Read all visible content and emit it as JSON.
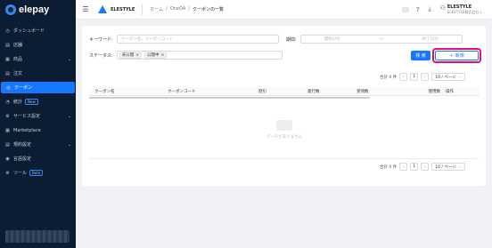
{
  "sidebar": {
    "brand": "elepay",
    "items": [
      {
        "icon": "◷",
        "label": "ダッシュボード",
        "chev": "",
        "badge": ""
      },
      {
        "icon": "▤",
        "label": "店舗",
        "chev": "",
        "badge": ""
      },
      {
        "icon": "▦",
        "label": "商品",
        "chev": "⌄",
        "badge": ""
      },
      {
        "icon": "▤",
        "label": "注文",
        "chev": "",
        "badge": ""
      },
      {
        "icon": "◎",
        "label": "クーポン",
        "chev": "",
        "badge": "",
        "active": true
      },
      {
        "icon": "◔",
        "label": "統計",
        "chev": "",
        "badge": "New"
      },
      {
        "icon": "⚙",
        "label": "サービス設定",
        "chev": "⌄",
        "badge": ""
      },
      {
        "icon": "▦",
        "label": "Marketplace",
        "chev": "",
        "badge": ""
      },
      {
        "icon": "▤",
        "label": "規約設定",
        "chev": "⌄",
        "badge": ""
      },
      {
        "icon": "◉",
        "label": "言語設定",
        "chev": "",
        "badge": ""
      },
      {
        "icon": "⚙",
        "label": "ツール",
        "chev": "",
        "badge": "Beta"
      }
    ]
  },
  "header": {
    "company": "ELESTYLE",
    "breadcrumb": [
      "ホーム",
      "OneQA",
      "クーポンの一覧"
    ],
    "separator": "/",
    "user_name": "ELESTYLE",
    "user_sub": "ELESTYLE株式会社 (..."
  },
  "filters": {
    "keyword_label": "キーワード:",
    "keyword_placeholder": "クーポン名、クーポンコード",
    "period_label": "期間:",
    "start_placeholder": "開始日付",
    "end_placeholder": "終了日付",
    "range_sep": "→",
    "status_label": "ステータス:",
    "status_tags": [
      "未公開",
      "公開中"
    ],
    "tag_close": "×",
    "search_button": "検 索",
    "new_button": "＋ 新規"
  },
  "pagination": {
    "total": "合計 0 件",
    "prev": "‹",
    "page": "1",
    "next": "›",
    "page_size": "10 / ページ",
    "size_chev": "⌄"
  },
  "table": {
    "columns": [
      "クーポン名",
      "クーポンコード",
      "割引",
      "発行数",
      "受領数",
      "使用数",
      "操作"
    ],
    "empty_text": "データがありません"
  },
  "colors": {
    "primary": "#1677ff",
    "sidebar_bg": "#0b1c33",
    "highlight": "#e0107a"
  }
}
